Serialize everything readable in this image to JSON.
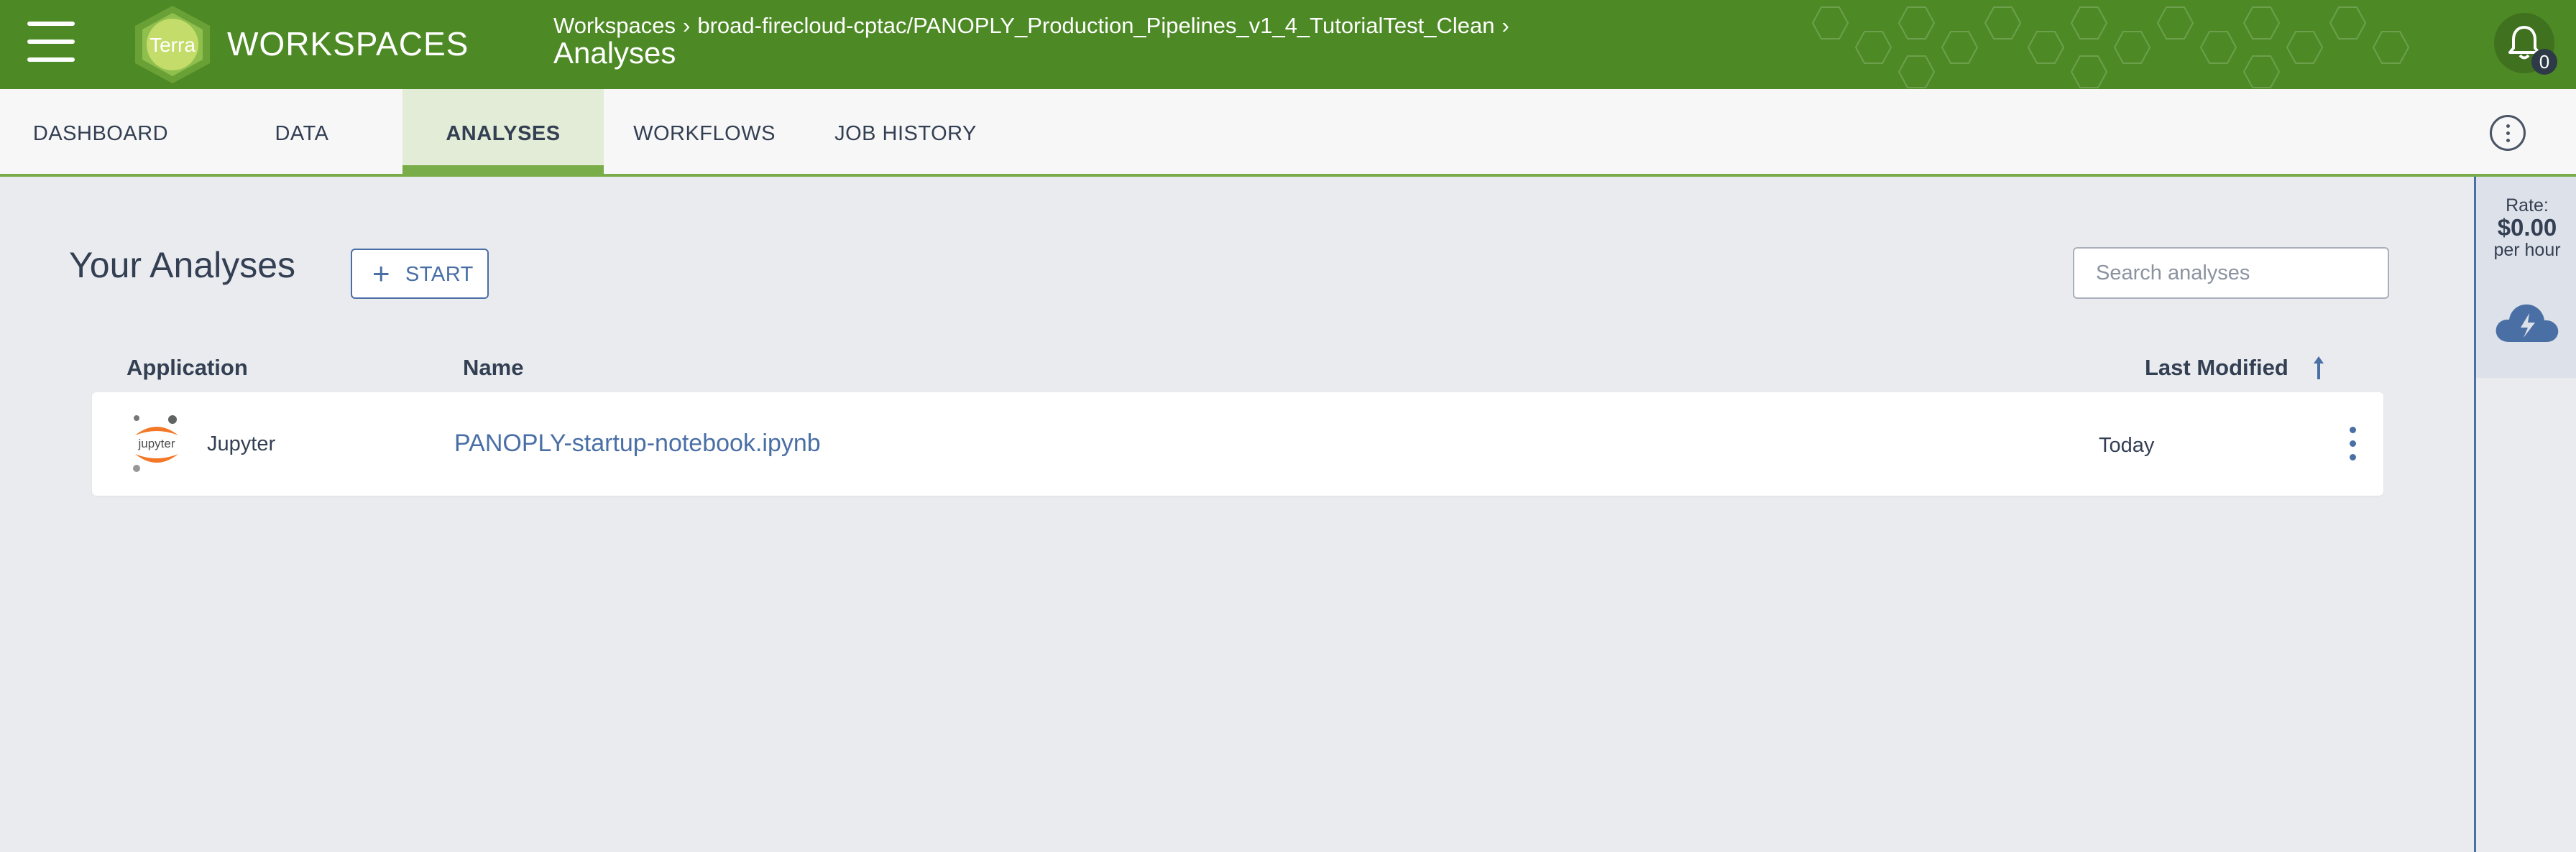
{
  "header": {
    "brand": "WORKSPACES",
    "logo_text": "Terra",
    "breadcrumb": [
      "Workspaces",
      "broad-firecloud-cptac/PANOPLY_Production_Pipelines_v1_4_TutorialTest_Clean"
    ],
    "breadcrumb_sep": "›",
    "page_title": "Analyses",
    "notification_count": "0",
    "colors": {
      "header_bg": "#4d8a25",
      "accent": "#78ad49",
      "link": "#4a6fa5"
    }
  },
  "tabs": [
    {
      "label": "DASHBOARD"
    },
    {
      "label": "DATA"
    },
    {
      "label": "ANALYSES",
      "active": true
    },
    {
      "label": "WORKFLOWS"
    },
    {
      "label": "JOB HISTORY"
    }
  ],
  "rate_panel": {
    "label": "Rate:",
    "value": "$0.00",
    "unit": "per hour"
  },
  "main": {
    "title": "Your Analyses",
    "start_plus": "+",
    "start_label": "START",
    "search_placeholder": "Search analyses",
    "columns": {
      "application": "Application",
      "name": "Name",
      "last_modified": "Last Modified"
    },
    "rows": [
      {
        "app_icon_text": "jupyter",
        "application": "Jupyter",
        "name": "PANOPLY-startup-notebook.ipynb",
        "last_modified": "Today"
      }
    ]
  }
}
